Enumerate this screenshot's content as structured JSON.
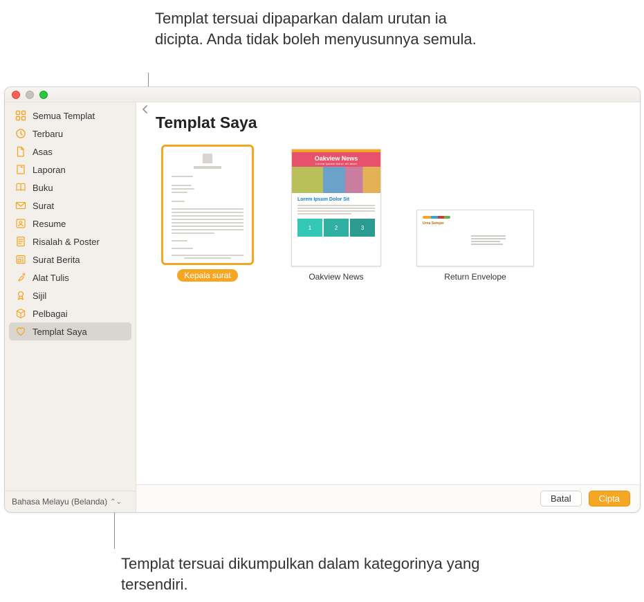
{
  "annotations": {
    "top": "Templat tersuai dipaparkan dalam urutan ia dicipta. Anda tidak boleh menyusunnya semula.",
    "bottom": "Templat tersuai dikumpulkan dalam kategorinya yang tersendiri."
  },
  "sidebar": {
    "items": [
      {
        "label": "Semua Templat",
        "icon": "grid-icon"
      },
      {
        "label": "Terbaru",
        "icon": "clock-icon"
      },
      {
        "label": "Asas",
        "icon": "doc-icon"
      },
      {
        "label": "Laporan",
        "icon": "report-icon"
      },
      {
        "label": "Buku",
        "icon": "book-icon"
      },
      {
        "label": "Surat",
        "icon": "envelope-icon"
      },
      {
        "label": "Resume",
        "icon": "person-icon"
      },
      {
        "label": "Risalah & Poster",
        "icon": "poster-icon"
      },
      {
        "label": "Surat Berita",
        "icon": "newspaper-icon"
      },
      {
        "label": "Alat Tulis",
        "icon": "stationery-icon"
      },
      {
        "label": "Sijil",
        "icon": "ribbon-icon"
      },
      {
        "label": "Pelbagai",
        "icon": "cube-icon"
      },
      {
        "label": "Templat Saya",
        "icon": "heart-icon"
      }
    ],
    "selected_index": 12
  },
  "language_selector": "Bahasa Melayu (Belanda)",
  "main": {
    "title": "Templat Saya",
    "templates": [
      {
        "label": "Kepala surat",
        "selected": true
      },
      {
        "label": "Oakview News",
        "selected": false
      },
      {
        "label": "Return Envelope",
        "selected": false
      }
    ],
    "oakview": {
      "header": "Oakview News",
      "sub": "Lorem ipsum dolor sit amet",
      "article": "Lorem Ipsum Dolor Sit"
    }
  },
  "footer": {
    "cancel": "Batal",
    "create": "Cipta"
  }
}
